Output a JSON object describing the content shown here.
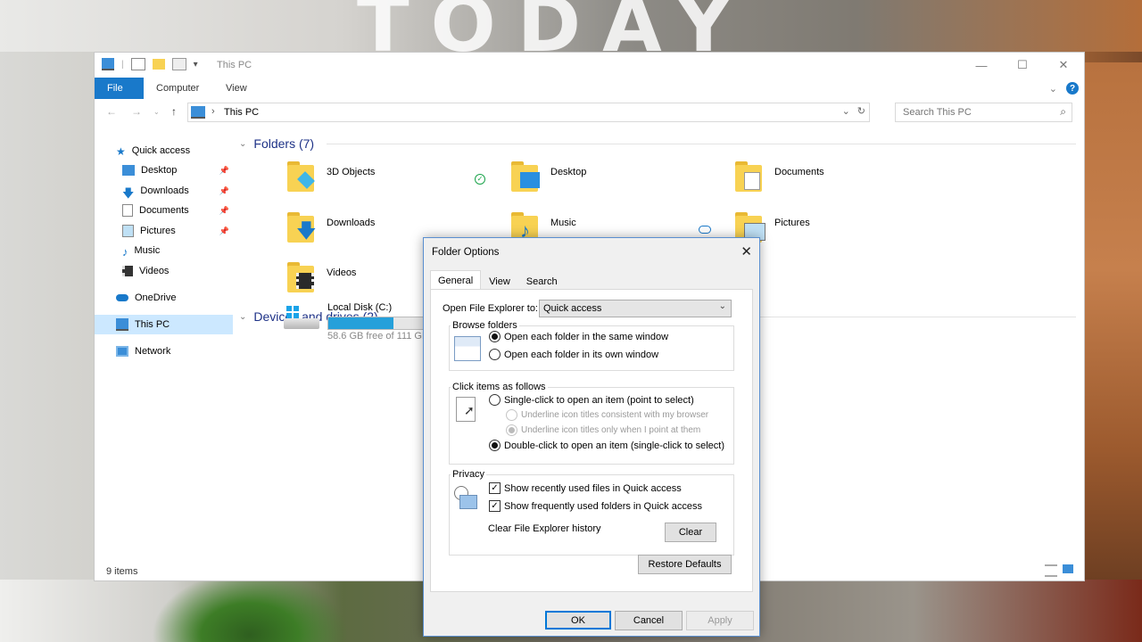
{
  "background": {
    "word": "TODAY"
  },
  "explorer": {
    "title": "This PC",
    "ribbon_tabs": [
      "File",
      "Computer",
      "View"
    ],
    "address": "This PC",
    "search_placeholder": "Search This PC",
    "nav": [
      {
        "label": "Quick access",
        "icon": "star-icon"
      },
      {
        "label": "Desktop",
        "icon": "desktop-icon",
        "pinned": true
      },
      {
        "label": "Downloads",
        "icon": "download-icon",
        "pinned": true
      },
      {
        "label": "Documents",
        "icon": "documents-icon",
        "pinned": true
      },
      {
        "label": "Pictures",
        "icon": "pictures-icon",
        "pinned": true
      },
      {
        "label": "Music",
        "icon": "music-icon"
      },
      {
        "label": "Videos",
        "icon": "videos-icon"
      },
      {
        "label": "OneDrive",
        "icon": "cloud-icon"
      },
      {
        "label": "This PC",
        "icon": "computer-icon",
        "selected": true
      },
      {
        "label": "Network",
        "icon": "network-icon"
      }
    ],
    "folders_header": "Folders (7)",
    "folders": [
      "3D Objects",
      "Desktop",
      "Documents",
      "Downloads",
      "Music",
      "Pictures",
      "Videos"
    ],
    "devices_header": "Devices and drives (2)",
    "drive": {
      "name": "Local Disk (C:)",
      "free": "58.6 GB free of 111 GB",
      "used_fraction": 0.47
    },
    "status": "9 items"
  },
  "dialog": {
    "title": "Folder Options",
    "tabs": [
      "General",
      "View",
      "Search"
    ],
    "open_label": "Open File Explorer to:",
    "open_value": "Quick access",
    "browse_title": "Browse folders",
    "browse_same": "Open each folder in the same window",
    "browse_own": "Open each folder in its own window",
    "click_title": "Click items as follows",
    "single_click": "Single-click to open an item (point to select)",
    "underline_browser": "Underline icon titles consistent with my browser",
    "underline_point": "Underline icon titles only when I point at them",
    "double_click": "Double-click to open an item (single-click to select)",
    "privacy_title": "Privacy",
    "recent_files": "Show recently used files in Quick access",
    "frequent_folders": "Show frequently used folders in Quick access",
    "clear_history": "Clear File Explorer history",
    "clear_btn": "Clear",
    "restore_btn": "Restore Defaults",
    "ok": "OK",
    "cancel": "Cancel",
    "apply": "Apply"
  }
}
